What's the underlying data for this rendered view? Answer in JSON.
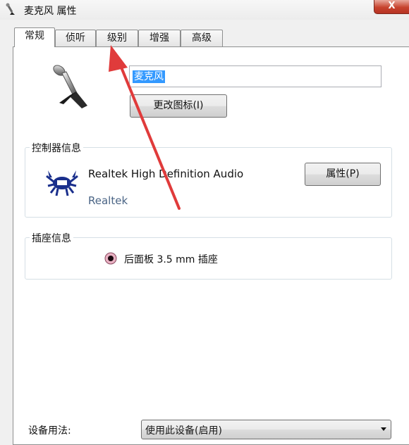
{
  "window": {
    "title": "麦克风 属性",
    "close_label": "X",
    "close_color": "#c7432e"
  },
  "tabs": [
    {
      "label": "常规",
      "active": true
    },
    {
      "label": "侦听",
      "active": false
    },
    {
      "label": "级别",
      "active": false
    },
    {
      "label": "增强",
      "active": false
    },
    {
      "label": "高级",
      "active": false
    }
  ],
  "general": {
    "device_icon": "microphone-icon",
    "name_value": "麦克风",
    "change_icon_label": "更改图标(I)"
  },
  "controller": {
    "group_label": "控制器信息",
    "icon": "realtek-crab-icon",
    "name": "Realtek High Definition Audio",
    "vendor": "Realtek",
    "properties_label": "属性(P)"
  },
  "jack": {
    "group_label": "插座信息",
    "icon": "jack-pink-icon",
    "description": "后面板 3.5 mm 插座"
  },
  "usage": {
    "label": "设备用法:",
    "selected": "使用此设备(启用)"
  },
  "annotation": {
    "icon": "red-arrow-icon",
    "color": "#e03b3b"
  }
}
